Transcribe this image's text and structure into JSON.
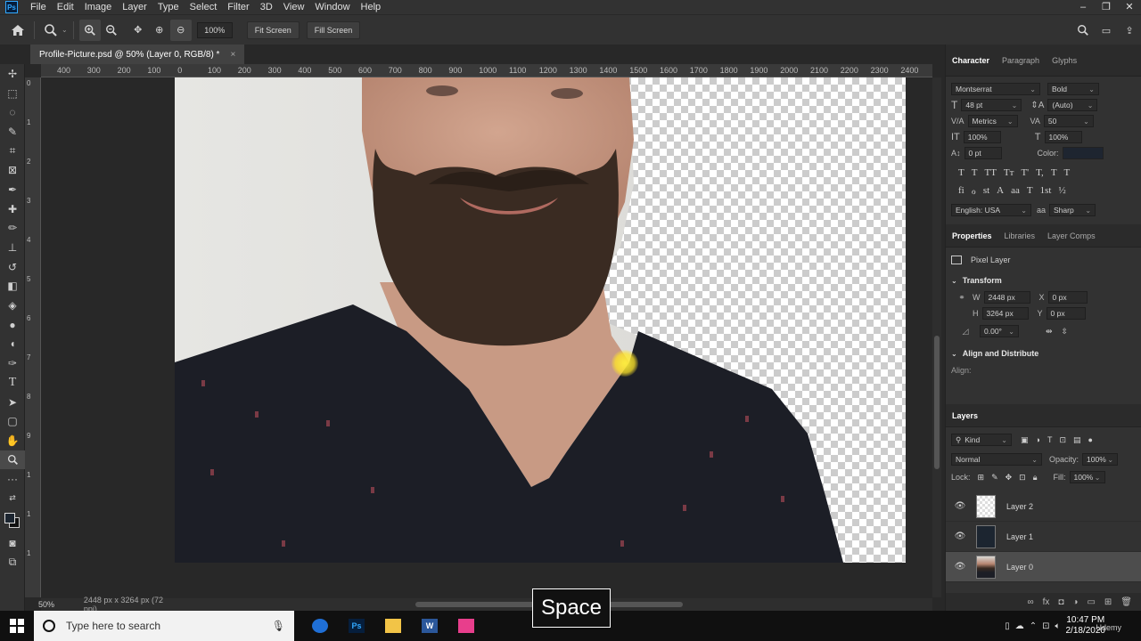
{
  "menu": {
    "logo": "Ps",
    "items": [
      "File",
      "Edit",
      "Image",
      "Layer",
      "Type",
      "Select",
      "Filter",
      "3D",
      "View",
      "Window",
      "Help"
    ]
  },
  "options": {
    "zoom_value": "100%",
    "fit_screen": "Fit Screen",
    "fill_screen": "Fill Screen"
  },
  "document": {
    "tab_title": "Profile-Picture.psd @ 50% (Layer 0, RGB/8) *",
    "close": "×"
  },
  "ruler_h": [
    "400",
    "300",
    "200",
    "100",
    "0",
    "100",
    "200",
    "300",
    "400",
    "500",
    "600",
    "700",
    "800",
    "900",
    "1000",
    "1100",
    "1200",
    "1300",
    "1400",
    "1500",
    "1600",
    "1700",
    "1800",
    "1900",
    "2000",
    "2100",
    "2200",
    "2300",
    "2400"
  ],
  "ruler_v": [
    "0",
    "1",
    "2",
    "3",
    "4",
    "5",
    "6",
    "7",
    "8",
    "9",
    "1",
    "1",
    "1"
  ],
  "status": {
    "zoom": "50%",
    "dimensions": "2448 px x 3264 px (72 ppi)"
  },
  "character": {
    "tabs": [
      "Character",
      "Paragraph",
      "Glyphs"
    ],
    "font_family": "Montserrat",
    "font_style": "Bold",
    "size": "48 pt",
    "leading": "(Auto)",
    "kerning": "Metrics",
    "tracking": "50",
    "vscale": "100%",
    "hscale": "100%",
    "baseline": "0 pt",
    "color_label": "Color:",
    "type_buttons": [
      "T",
      "T",
      "TT",
      "Tт",
      "T'",
      "T,",
      "T",
      "T"
    ],
    "ot_buttons": [
      "fi",
      "ℴ",
      "st",
      "A",
      "aa",
      "T",
      "1st",
      "½"
    ],
    "language": "English: USA",
    "antialias": "Sharp",
    "color_swatch": "#1e2530"
  },
  "properties": {
    "tabs": [
      "Properties",
      "Libraries",
      "Layer Comps"
    ],
    "layer_type": "Pixel Layer",
    "transform_title": "Transform",
    "w_label": "W",
    "w_value": "2448 px",
    "h_label": "H",
    "h_value": "3264 px",
    "x_label": "X",
    "x_value": "0 px",
    "y_label": "Y",
    "y_value": "0 px",
    "angle": "0.00°",
    "align_title": "Align and Distribute",
    "align_label": "Align:"
  },
  "layers": {
    "tab": "Layers",
    "filter": "Kind",
    "blend_mode": "Normal",
    "opacity_label": "Opacity:",
    "opacity": "100%",
    "lock_label": "Lock:",
    "fill_label": "Fill:",
    "fill": "100%",
    "items": [
      {
        "name": "Layer 2",
        "thumb": "transparent",
        "selected": false
      },
      {
        "name": "Layer 1",
        "thumb": "#1c2530",
        "selected": false
      },
      {
        "name": "Layer 0",
        "thumb": "photo",
        "selected": true
      }
    ],
    "bottom_icons": [
      "∞",
      "fx",
      "◘",
      "◑",
      "▭",
      "⊞",
      "🗑"
    ]
  },
  "taskbar": {
    "search_placeholder": "Type here to search",
    "time": "10:47 PM",
    "date": "2/18/2020",
    "apps": [
      {
        "name": "firefox",
        "label": "",
        "bg": "#1f6fd6",
        "fg": "#fff"
      },
      {
        "name": "photoshop",
        "label": "Ps",
        "bg": "#061e3c",
        "fg": "#31a8ff"
      },
      {
        "name": "file-explorer",
        "label": "",
        "bg": "#f2c447",
        "fg": "#000"
      },
      {
        "name": "word",
        "label": "W",
        "bg": "#2b579a",
        "fg": "#fff"
      },
      {
        "name": "app-colorful",
        "label": "",
        "bg": "#e83e8c",
        "fg": "#fff"
      }
    ]
  },
  "overlay": {
    "key_label": "Space",
    "watermark": "Udemy"
  }
}
